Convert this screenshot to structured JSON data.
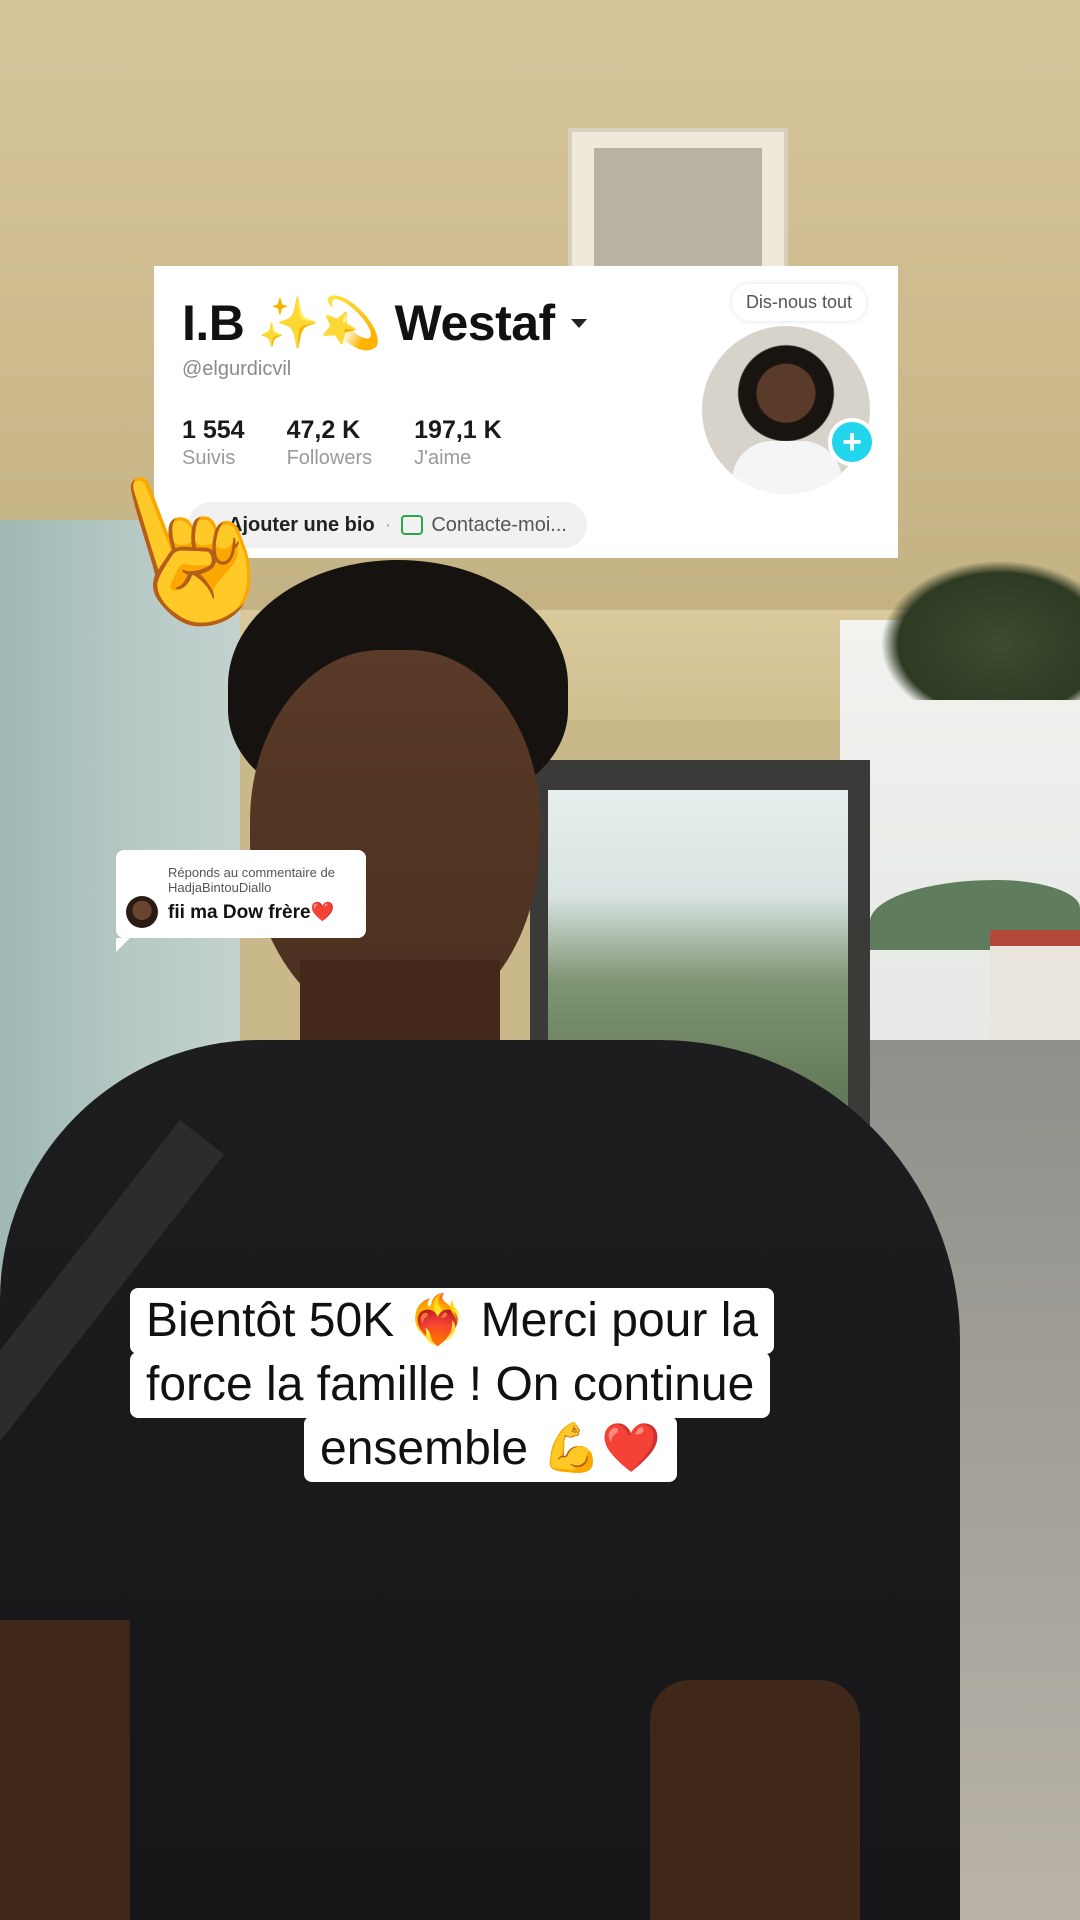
{
  "profile": {
    "display_name": "I.B ✨💫 Westaf",
    "handle": "@elgurdicvil",
    "tell_us_label": "Dis-nous tout",
    "stats": [
      {
        "value": "1 554",
        "label": "Suivis"
      },
      {
        "value": "47,2 K",
        "label": "Followers"
      },
      {
        "value": "197,1 K",
        "label": "J'aime"
      }
    ],
    "bio_add_label": "Ajouter une bio",
    "bio_separator": "·",
    "contact_label": "Contacte-moi..."
  },
  "reply": {
    "header_line1": "Réponds au commentaire de",
    "header_line2": "HadjaBintouDiallo",
    "comment": "fii ma Dow frère❤️"
  },
  "caption": {
    "line1": "Bientôt  50K ❤️‍🔥 Merci pour la",
    "line2": "force la famille ! On continue",
    "line3": "ensemble 💪❤️"
  },
  "pointing_emoji": "☝️",
  "colors": {
    "follow_plus": "#20d5ec",
    "contact_icon": "#2ba64d"
  }
}
